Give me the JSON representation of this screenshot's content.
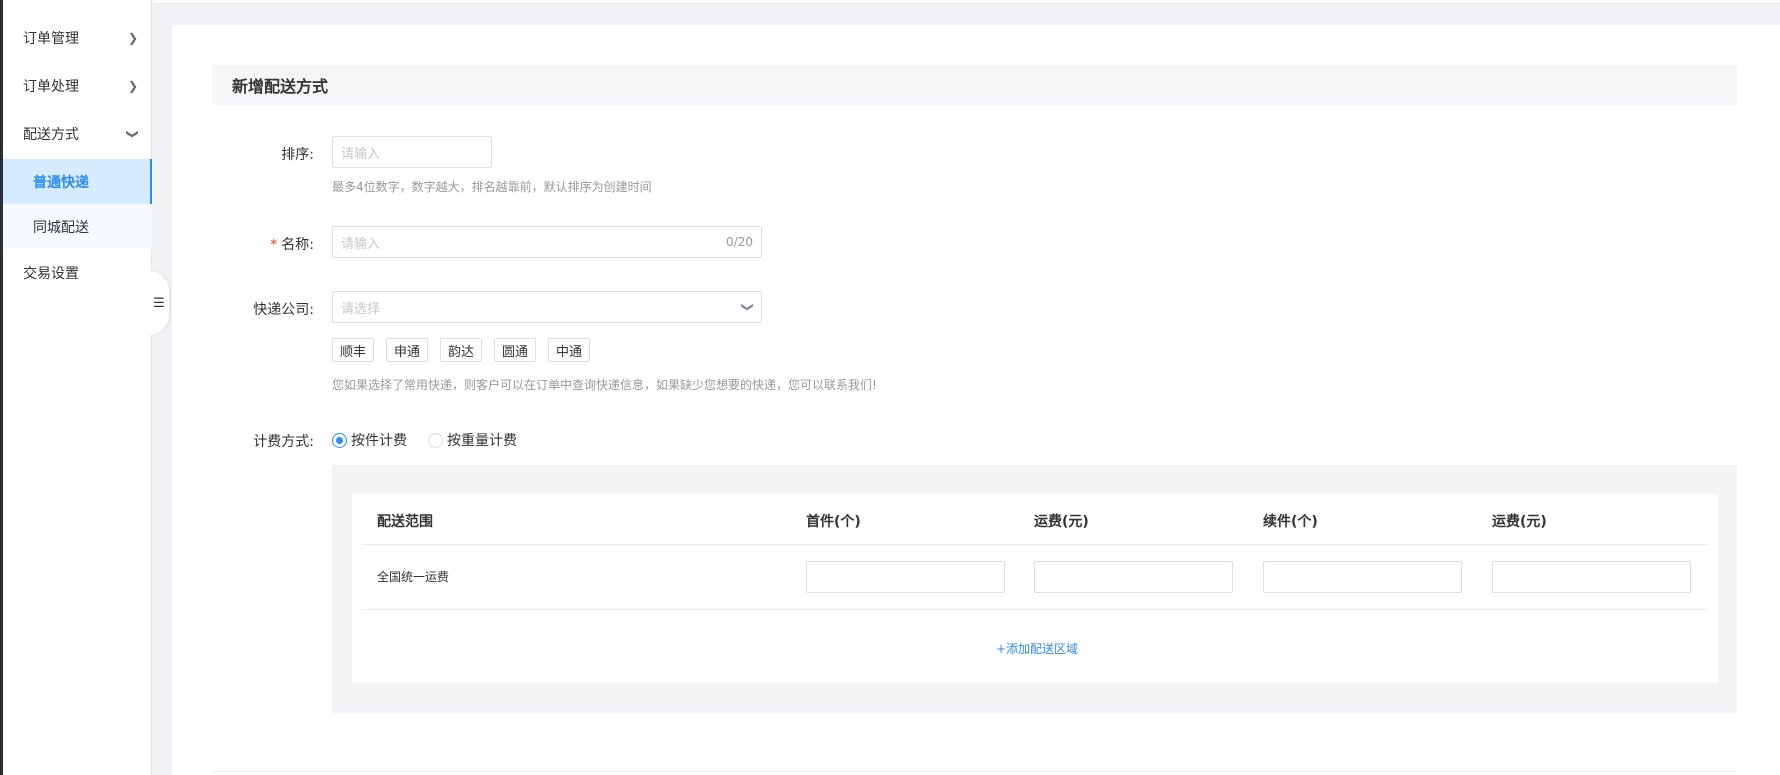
{
  "sidebar": {
    "items": [
      {
        "label": "订单管理",
        "chevron": "chevron-right-icon"
      },
      {
        "label": "订单处理",
        "chevron": "chevron-right-icon"
      },
      {
        "label": "配送方式",
        "chevron": "chevron-down-icon"
      },
      {
        "label": "交易设置"
      }
    ],
    "sub_items": [
      {
        "label": "普通快递",
        "active": true
      },
      {
        "label": "同城配送",
        "active": false
      }
    ],
    "collapse_icon": "menu-collapse-icon",
    "accent_color": "#2d8cf0"
  },
  "form": {
    "section_title": "新增配送方式",
    "sort": {
      "label": "排序:",
      "placeholder": "请输入",
      "hint": "最多4位数字，数字越大，排名越靠前，默认排序为创建时间"
    },
    "name": {
      "required_mark": "*",
      "label": "名称:",
      "placeholder": "请输入",
      "counter": "0/20"
    },
    "courier": {
      "label": "快递公司:",
      "placeholder": "请选择",
      "tags": [
        "顺丰",
        "申通",
        "韵达",
        "圆通",
        "中通"
      ],
      "hint": "您如果选择了常用快递，则客户可以在订单中查询快递信息，如果缺少您想要的快递，您可以联系我们!"
    },
    "billing": {
      "label": "计费方式:",
      "options": [
        {
          "label": "按件计费",
          "checked": true
        },
        {
          "label": "按重量计费",
          "checked": false
        }
      ]
    },
    "table": {
      "headers": [
        "配送范围",
        "首件(个)",
        "运费(元)",
        "续件(个)",
        "运费(元)"
      ],
      "rows": [
        {
          "region": "全国统一运费",
          "first_qty": "",
          "first_fee": "",
          "extra_qty": "",
          "extra_fee": ""
        }
      ],
      "add_link": "+添加配送区域"
    }
  }
}
